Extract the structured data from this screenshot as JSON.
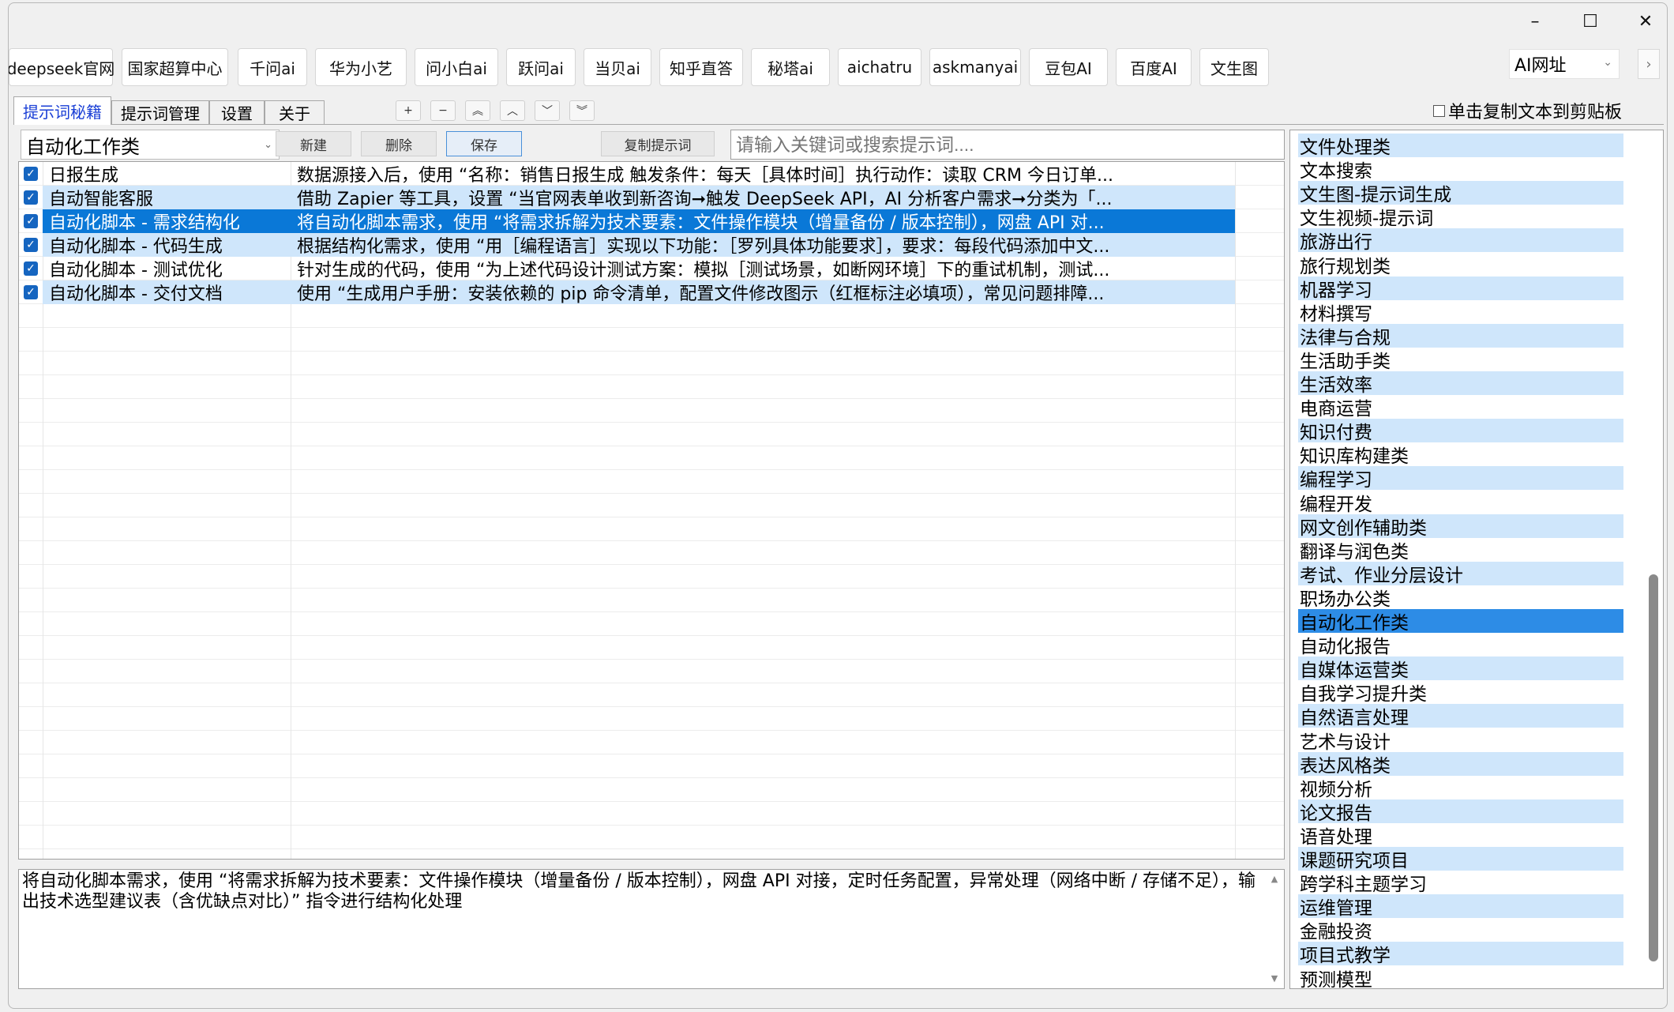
{
  "window_controls": {
    "minimize": "–",
    "maximize": "☐",
    "close": "✕"
  },
  "site_buttons": [
    "deepseek官网",
    "国家超算中心",
    "千问ai",
    "华为小艺",
    "问小白ai",
    "跃问ai",
    "当贝ai",
    "知乎直答",
    "秘塔ai",
    "aichatru",
    "askmanyai",
    "豆包AI",
    "百度AI",
    "文生图"
  ],
  "ai_select": {
    "value": "AI网址",
    "chevron": "⌄",
    "go_glyph": "›"
  },
  "tabs": [
    "提示词秘籍",
    "提示词管理",
    "设置",
    "关于"
  ],
  "active_tab_index": 0,
  "mini_buttons": [
    "+",
    "−",
    "︽",
    "︿",
    "﹀",
    "︾"
  ],
  "copy_checkbox": {
    "label": "单击复制文本到剪贴板",
    "checked": false
  },
  "toolbar": {
    "category_value": "自动化工作类",
    "new_label": "新建",
    "delete_label": "删除",
    "save_label": "保存",
    "copy_label": "复制提示词",
    "search_placeholder": "请输入关键词或搜索提示词...."
  },
  "prompt_rows": [
    {
      "title": "日报生成",
      "content": "数据源接入后，使用 “名称：销售日报生成 触发条件：每天［具体时间］执行动作：读取 CRM 今日订单...",
      "checked": true,
      "state": "normal"
    },
    {
      "title": "自动智能客服",
      "content": "借助 Zapier 等工具，设置 “当官网表单收到新咨询➞触发 DeepSeek API，AI 分析客户需求➞分类为「...",
      "checked": true,
      "state": "alt"
    },
    {
      "title": "自动化脚本 - 需求结构化",
      "content": "将自动化脚本需求，使用 “将需求拆解为技术要素：文件操作模块（增量备份 / 版本控制），网盘 API 对...",
      "checked": true,
      "state": "selected"
    },
    {
      "title": "自动化脚本 - 代码生成",
      "content": "根据结构化需求，使用 “用［编程语言］实现以下功能：［罗列具体功能要求］，要求：每段代码添加中文...",
      "checked": true,
      "state": "alt"
    },
    {
      "title": "自动化脚本 - 测试优化",
      "content": "针对生成的代码，使用 “为上述代码设计测试方案：模拟［测试场景，如断网环境］下的重试机制，测试...",
      "checked": true,
      "state": "normal"
    },
    {
      "title": "自动化脚本 - 交付文档",
      "content": "使用 “生成用户手册：安装依赖的 pip 命令清单，配置文件修改图示（红框标注必填项），常见问题排障...",
      "checked": true,
      "state": "alt"
    }
  ],
  "detail_text": "将自动化脚本需求，使用 “将需求拆解为技术要素：文件操作模块（增量备份 / 版本控制），网盘 API 对接，定时任务配置，异常处理（网络中断 / 存储不足），输出技术选型建议表（含优缺点对比）” 指令进行结构化处理",
  "scroll_glyphs": {
    "up": "▲",
    "down": "▼"
  },
  "categories": [
    "文件处理类",
    "文本搜索",
    "文生图-提示词生成",
    "文生视频-提示词",
    "旅游出行",
    "旅行规划类",
    "机器学习",
    "材料撰写",
    "法律与合规",
    "生活助手类",
    "生活效率",
    "电商运营",
    "知识付费",
    "知识库构建类",
    "编程学习",
    "编程开发",
    "网文创作辅助类",
    "翻译与润色类",
    "考试、作业分层设计",
    "职场办公类",
    "自动化工作类",
    "自动化报告",
    "自媒体运营类",
    "自我学习提升类",
    "自然语言处理",
    "艺术与设计",
    "表达风格类",
    "视频分析",
    "论文报告",
    "语音处理",
    "课题研究项目",
    "跨学科主题学习",
    "运维管理",
    "金融投资",
    "项目式教学",
    "预测模型"
  ],
  "selected_category": "自动化工作类"
}
